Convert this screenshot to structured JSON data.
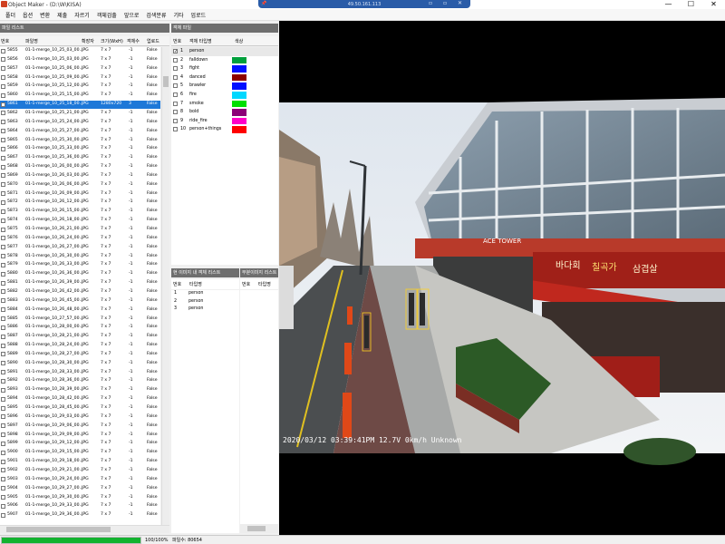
{
  "window": {
    "title": "Object Maker - (D:\\W\\KISA)",
    "minimize": "—",
    "maximize": "☐",
    "close": "✕"
  },
  "remote_bar": {
    "address": "49.50.161.113",
    "pin_icon": "pin-icon",
    "icons": "▫ ▫ ✕"
  },
  "menu": [
    "폴더",
    "옵션",
    "변환",
    "제출",
    "자르기",
    "객체검출",
    "앞으로",
    "검색분류",
    "기타",
    "업로드"
  ],
  "file_list": {
    "header": "파일 리스트",
    "columns": [
      "번호",
      "파일명",
      "확장자",
      "크기(WxH)",
      "객체수",
      "업로드"
    ],
    "rows": [
      [
        "5855",
        "01-1-merge_10_25_03_00...",
        "JPG",
        "7 x 7",
        "-1",
        "False"
      ],
      [
        "5856",
        "01-1-merge_10_25_03_00...",
        "JPG",
        "7 x 7",
        "-1",
        "False"
      ],
      [
        "5857",
        "01-1-merge_10_25_06_00...",
        "JPG",
        "7 x 7",
        "-1",
        "False"
      ],
      [
        "5858",
        "01-1-merge_10_25_09_00...",
        "JPG",
        "7 x 7",
        "-1",
        "False"
      ],
      [
        "5859",
        "01-1-merge_10_25_12_00...",
        "JPG",
        "7 x 7",
        "-1",
        "False"
      ],
      [
        "5860",
        "01-1-merge_10_25_15_00...",
        "JPG",
        "7 x 7",
        "-1",
        "False"
      ],
      [
        "5861",
        "01-1-merge_10_25_18_00...",
        "JPG",
        "1280x720",
        "3",
        "False"
      ],
      [
        "5862",
        "01-1-merge_10_25_21_00...",
        "JPG",
        "7 x 7",
        "-1",
        "False"
      ],
      [
        "5863",
        "01-1-merge_10_25_24_00...",
        "JPG",
        "7 x 7",
        "-1",
        "False"
      ],
      [
        "5864",
        "01-1-merge_10_25_27_00...",
        "JPG",
        "7 x 7",
        "-1",
        "False"
      ],
      [
        "5865",
        "01-1-merge_10_25_30_00...",
        "JPG",
        "7 x 7",
        "-1",
        "False"
      ],
      [
        "5866",
        "01-1-merge_10_25_33_00...",
        "JPG",
        "7 x 7",
        "-1",
        "False"
      ],
      [
        "5867",
        "01-1-merge_10_25_36_00...",
        "JPG",
        "7 x 7",
        "-1",
        "False"
      ],
      [
        "5868",
        "01-1-merge_10_26_00_00...",
        "JPG",
        "7 x 7",
        "-1",
        "False"
      ],
      [
        "5869",
        "01-1-merge_10_26_03_00...",
        "JPG",
        "7 x 7",
        "-1",
        "False"
      ],
      [
        "5870",
        "01-1-merge_10_26_06_00...",
        "JPG",
        "7 x 7",
        "-1",
        "False"
      ],
      [
        "5871",
        "01-1-merge_10_26_09_00...",
        "JPG",
        "7 x 7",
        "-1",
        "False"
      ],
      [
        "5872",
        "01-1-merge_10_26_12_00...",
        "JPG",
        "7 x 7",
        "-1",
        "False"
      ],
      [
        "5873",
        "01-1-merge_10_26_15_00...",
        "JPG",
        "7 x 7",
        "-1",
        "False"
      ],
      [
        "5874",
        "01-1-merge_10_26_18_00...",
        "JPG",
        "7 x 7",
        "-1",
        "False"
      ],
      [
        "5875",
        "01-1-merge_10_26_21_00...",
        "JPG",
        "7 x 7",
        "-1",
        "False"
      ],
      [
        "5876",
        "01-1-merge_10_26_24_00...",
        "JPG",
        "7 x 7",
        "-1",
        "False"
      ],
      [
        "5877",
        "01-1-merge_10_26_27_00...",
        "JPG",
        "7 x 7",
        "-1",
        "False"
      ],
      [
        "5878",
        "01-1-merge_10_26_30_00...",
        "JPG",
        "7 x 7",
        "-1",
        "False"
      ],
      [
        "5879",
        "01-1-merge_10_26_33_00...",
        "JPG",
        "7 x 7",
        "-1",
        "False"
      ],
      [
        "5880",
        "01-1-merge_10_26_36_00...",
        "JPG",
        "7 x 7",
        "-1",
        "False"
      ],
      [
        "5881",
        "01-1-merge_10_26_39_00...",
        "JPG",
        "7 x 7",
        "-1",
        "False"
      ],
      [
        "5882",
        "01-1-merge_10_26_42_00...",
        "JPG",
        "7 x 7",
        "-1",
        "False"
      ],
      [
        "5883",
        "01-1-merge_10_26_45_00...",
        "JPG",
        "7 x 7",
        "-1",
        "False"
      ],
      [
        "5884",
        "01-1-merge_10_26_48_00...",
        "JPG",
        "7 x 7",
        "-1",
        "False"
      ],
      [
        "5885",
        "01-1-merge_10_27_57_00...",
        "JPG",
        "7 x 7",
        "-1",
        "False"
      ],
      [
        "5886",
        "01-1-merge_10_28_00_00...",
        "JPG",
        "7 x 7",
        "-1",
        "False"
      ],
      [
        "5887",
        "01-1-merge_10_28_21_00...",
        "JPG",
        "7 x 7",
        "-1",
        "False"
      ],
      [
        "5888",
        "01-1-merge_10_28_24_00...",
        "JPG",
        "7 x 7",
        "-1",
        "False"
      ],
      [
        "5889",
        "01-1-merge_10_28_27_00...",
        "JPG",
        "7 x 7",
        "-1",
        "False"
      ],
      [
        "5890",
        "01-1-merge_10_28_30_00...",
        "JPG",
        "7 x 7",
        "-1",
        "False"
      ],
      [
        "5891",
        "01-1-merge_10_28_33_00...",
        "JPG",
        "7 x 7",
        "-1",
        "False"
      ],
      [
        "5892",
        "01-1-merge_10_28_36_00...",
        "JPG",
        "7 x 7",
        "-1",
        "False"
      ],
      [
        "5893",
        "01-1-merge_10_28_39_00...",
        "JPG",
        "7 x 7",
        "-1",
        "False"
      ],
      [
        "5894",
        "01-1-merge_10_28_42_00...",
        "JPG",
        "7 x 7",
        "-1",
        "False"
      ],
      [
        "5895",
        "01-1-merge_10_28_45_00...",
        "JPG",
        "7 x 7",
        "-1",
        "False"
      ],
      [
        "5896",
        "01-1-merge_10_29_03_00...",
        "JPG",
        "7 x 7",
        "-1",
        "False"
      ],
      [
        "5897",
        "01-1-merge_10_29_06_00...",
        "JPG",
        "7 x 7",
        "-1",
        "False"
      ],
      [
        "5898",
        "01-1-merge_10_29_09_00...",
        "JPG",
        "7 x 7",
        "-1",
        "False"
      ],
      [
        "5899",
        "01-1-merge_10_29_12_00...",
        "JPG",
        "7 x 7",
        "-1",
        "False"
      ],
      [
        "5900",
        "01-1-merge_10_29_15_00...",
        "JPG",
        "7 x 7",
        "-1",
        "False"
      ],
      [
        "5901",
        "01-1-merge_10_29_18_00...",
        "JPG",
        "7 x 7",
        "-1",
        "False"
      ],
      [
        "5902",
        "01-1-merge_10_29_21_00...",
        "JPG",
        "7 x 7",
        "-1",
        "False"
      ],
      [
        "5903",
        "01-1-merge_10_29_24_00...",
        "JPG",
        "7 x 7",
        "-1",
        "False"
      ],
      [
        "5904",
        "01-1-merge_10_29_27_00...",
        "JPG",
        "7 x 7",
        "-1",
        "False"
      ],
      [
        "5905",
        "01-1-merge_10_29_30_00...",
        "JPG",
        "7 x 7",
        "-1",
        "False"
      ],
      [
        "5906",
        "01-1-merge_10_29_33_00...",
        "JPG",
        "7 x 7",
        "-1",
        "False"
      ],
      [
        "5907",
        "01-1-merge_10_29_36_00...",
        "JPG",
        "7 x 7",
        "-1",
        "False"
      ]
    ],
    "selected_index": 6,
    "scroll_up_icon": "▲",
    "scroll_down_icon": "▼"
  },
  "object_items": {
    "header": "객체 파일",
    "columns": [
      "번호",
      "객체 타입명",
      "색상"
    ],
    "rows": [
      {
        "num": "1",
        "name": "person",
        "color": "",
        "checked": true
      },
      {
        "num": "2",
        "name": "falldown",
        "color": "#00a03c",
        "checked": false
      },
      {
        "num": "3",
        "name": "fight",
        "color": "#0010ff",
        "checked": false
      },
      {
        "num": "4",
        "name": "danced",
        "color": "#8c0000",
        "checked": false
      },
      {
        "num": "5",
        "name": "brawler",
        "color": "#0010ff",
        "checked": false
      },
      {
        "num": "6",
        "name": "fire",
        "color": "#00d8ff",
        "checked": false
      },
      {
        "num": "7",
        "name": "smoke",
        "color": "#00e000",
        "checked": false
      },
      {
        "num": "8",
        "name": "bold",
        "color": "#8c0078",
        "checked": false
      },
      {
        "num": "9",
        "name": "ride_fire",
        "color": "#ff00c8",
        "checked": false
      },
      {
        "num": "10",
        "name": "person+things",
        "color": "#ff0000",
        "checked": false
      }
    ]
  },
  "image_objects": {
    "header": "현 이미지 내 객체 리스트",
    "columns": [
      "번호",
      "타입명"
    ],
    "rows": [
      {
        "num": "1",
        "name": "person"
      },
      {
        "num": "2",
        "name": "person"
      },
      {
        "num": "3",
        "name": "person"
      }
    ]
  },
  "prev_objects": {
    "header": "부분이미지 리스트",
    "columns": [
      "번호",
      "타입명"
    ]
  },
  "viewer": {
    "osd": "2020/03/12 03:39:41PM 12.7V  0km/h Unknown",
    "shop_signs": [
      "ACE TOWER",
      "바다회",
      "칠곡가",
      "삼겹살"
    ]
  },
  "status": {
    "progress": 1.0,
    "progress_text": "100/100%",
    "total_text": "파일수: 80654"
  }
}
